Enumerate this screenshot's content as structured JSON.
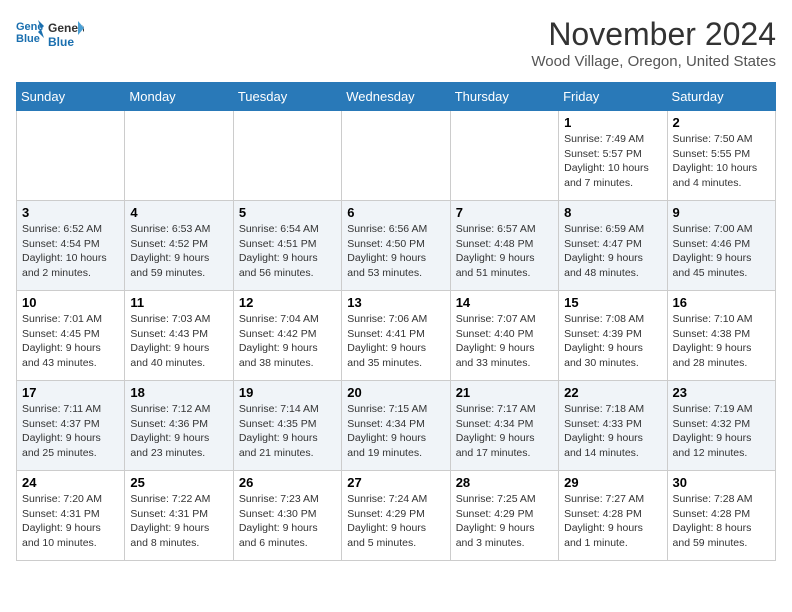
{
  "header": {
    "logo_line1": "General",
    "logo_line2": "Blue",
    "month": "November 2024",
    "location": "Wood Village, Oregon, United States"
  },
  "weekdays": [
    "Sunday",
    "Monday",
    "Tuesday",
    "Wednesday",
    "Thursday",
    "Friday",
    "Saturday"
  ],
  "weeks": [
    [
      {
        "day": "",
        "info": ""
      },
      {
        "day": "",
        "info": ""
      },
      {
        "day": "",
        "info": ""
      },
      {
        "day": "",
        "info": ""
      },
      {
        "day": "",
        "info": ""
      },
      {
        "day": "1",
        "info": "Sunrise: 7:49 AM\nSunset: 5:57 PM\nDaylight: 10 hours and 7 minutes."
      },
      {
        "day": "2",
        "info": "Sunrise: 7:50 AM\nSunset: 5:55 PM\nDaylight: 10 hours and 4 minutes."
      }
    ],
    [
      {
        "day": "3",
        "info": "Sunrise: 6:52 AM\nSunset: 4:54 PM\nDaylight: 10 hours and 2 minutes."
      },
      {
        "day": "4",
        "info": "Sunrise: 6:53 AM\nSunset: 4:52 PM\nDaylight: 9 hours and 59 minutes."
      },
      {
        "day": "5",
        "info": "Sunrise: 6:54 AM\nSunset: 4:51 PM\nDaylight: 9 hours and 56 minutes."
      },
      {
        "day": "6",
        "info": "Sunrise: 6:56 AM\nSunset: 4:50 PM\nDaylight: 9 hours and 53 minutes."
      },
      {
        "day": "7",
        "info": "Sunrise: 6:57 AM\nSunset: 4:48 PM\nDaylight: 9 hours and 51 minutes."
      },
      {
        "day": "8",
        "info": "Sunrise: 6:59 AM\nSunset: 4:47 PM\nDaylight: 9 hours and 48 minutes."
      },
      {
        "day": "9",
        "info": "Sunrise: 7:00 AM\nSunset: 4:46 PM\nDaylight: 9 hours and 45 minutes."
      }
    ],
    [
      {
        "day": "10",
        "info": "Sunrise: 7:01 AM\nSunset: 4:45 PM\nDaylight: 9 hours and 43 minutes."
      },
      {
        "day": "11",
        "info": "Sunrise: 7:03 AM\nSunset: 4:43 PM\nDaylight: 9 hours and 40 minutes."
      },
      {
        "day": "12",
        "info": "Sunrise: 7:04 AM\nSunset: 4:42 PM\nDaylight: 9 hours and 38 minutes."
      },
      {
        "day": "13",
        "info": "Sunrise: 7:06 AM\nSunset: 4:41 PM\nDaylight: 9 hours and 35 minutes."
      },
      {
        "day": "14",
        "info": "Sunrise: 7:07 AM\nSunset: 4:40 PM\nDaylight: 9 hours and 33 minutes."
      },
      {
        "day": "15",
        "info": "Sunrise: 7:08 AM\nSunset: 4:39 PM\nDaylight: 9 hours and 30 minutes."
      },
      {
        "day": "16",
        "info": "Sunrise: 7:10 AM\nSunset: 4:38 PM\nDaylight: 9 hours and 28 minutes."
      }
    ],
    [
      {
        "day": "17",
        "info": "Sunrise: 7:11 AM\nSunset: 4:37 PM\nDaylight: 9 hours and 25 minutes."
      },
      {
        "day": "18",
        "info": "Sunrise: 7:12 AM\nSunset: 4:36 PM\nDaylight: 9 hours and 23 minutes."
      },
      {
        "day": "19",
        "info": "Sunrise: 7:14 AM\nSunset: 4:35 PM\nDaylight: 9 hours and 21 minutes."
      },
      {
        "day": "20",
        "info": "Sunrise: 7:15 AM\nSunset: 4:34 PM\nDaylight: 9 hours and 19 minutes."
      },
      {
        "day": "21",
        "info": "Sunrise: 7:17 AM\nSunset: 4:34 PM\nDaylight: 9 hours and 17 minutes."
      },
      {
        "day": "22",
        "info": "Sunrise: 7:18 AM\nSunset: 4:33 PM\nDaylight: 9 hours and 14 minutes."
      },
      {
        "day": "23",
        "info": "Sunrise: 7:19 AM\nSunset: 4:32 PM\nDaylight: 9 hours and 12 minutes."
      }
    ],
    [
      {
        "day": "24",
        "info": "Sunrise: 7:20 AM\nSunset: 4:31 PM\nDaylight: 9 hours and 10 minutes."
      },
      {
        "day": "25",
        "info": "Sunrise: 7:22 AM\nSunset: 4:31 PM\nDaylight: 9 hours and 8 minutes."
      },
      {
        "day": "26",
        "info": "Sunrise: 7:23 AM\nSunset: 4:30 PM\nDaylight: 9 hours and 6 minutes."
      },
      {
        "day": "27",
        "info": "Sunrise: 7:24 AM\nSunset: 4:29 PM\nDaylight: 9 hours and 5 minutes."
      },
      {
        "day": "28",
        "info": "Sunrise: 7:25 AM\nSunset: 4:29 PM\nDaylight: 9 hours and 3 minutes."
      },
      {
        "day": "29",
        "info": "Sunrise: 7:27 AM\nSunset: 4:28 PM\nDaylight: 9 hours and 1 minute."
      },
      {
        "day": "30",
        "info": "Sunrise: 7:28 AM\nSunset: 4:28 PM\nDaylight: 8 hours and 59 minutes."
      }
    ]
  ]
}
